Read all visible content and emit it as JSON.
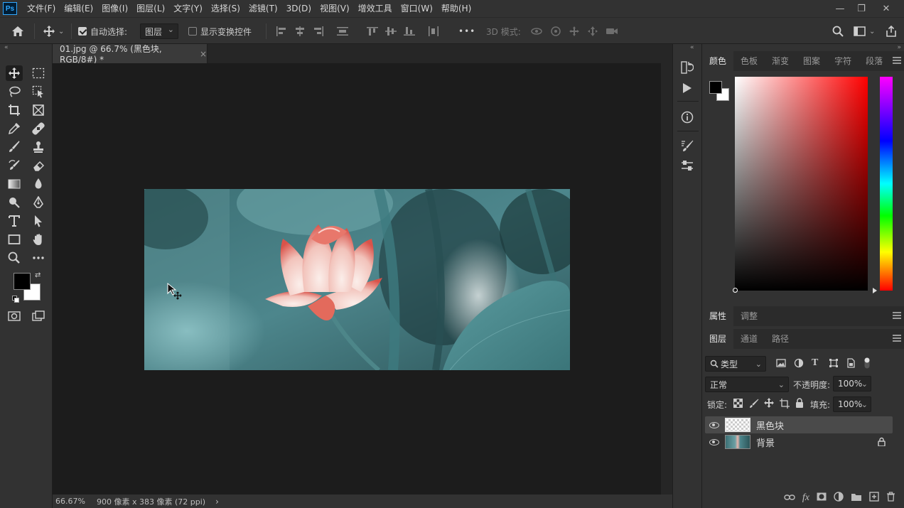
{
  "app": {
    "logo": "Ps"
  },
  "menu": [
    "文件(F)",
    "编辑(E)",
    "图像(I)",
    "图层(L)",
    "文字(Y)",
    "选择(S)",
    "滤镜(T)",
    "3D(D)",
    "视图(V)",
    "增效工具",
    "窗口(W)",
    "帮助(H)"
  ],
  "options": {
    "auto_select_label": "自动选择:",
    "auto_select_checked": true,
    "auto_select_target": "图层",
    "show_transform_label": "显示变换控件",
    "show_transform_checked": false,
    "mode3d_label": "3D 模式:",
    "more": "•••"
  },
  "document": {
    "tab_title": "01.jpg @ 66.7% (黑色块, RGB/8#) *",
    "close": "×"
  },
  "status": {
    "zoom": "66.67%",
    "info": "900 像素 x 383 像素 (72 ppi)",
    "arrow": "›"
  },
  "color_panel": {
    "tabs": [
      "颜色",
      "色板",
      "渐变",
      "图案",
      "字符",
      "段落"
    ],
    "selected_tab": "颜色",
    "foreground": "#000000",
    "background": "#ffffff",
    "hue_base": "#ff0000"
  },
  "properties_panel": {
    "tabs": [
      "属性",
      "调整"
    ]
  },
  "layers_panel": {
    "tabs": [
      "图层",
      "通道",
      "路径"
    ],
    "filter_label": "类型",
    "blend_mode": "正常",
    "opacity_label": "不透明度:",
    "opacity_value": "100%",
    "lock_label": "锁定:",
    "fill_label": "填充:",
    "fill_value": "100%",
    "layers": [
      {
        "name": "黑色块",
        "visible": true,
        "selected": true,
        "locked": false
      },
      {
        "name": "背景",
        "visible": true,
        "selected": false,
        "locked": true
      }
    ]
  },
  "colors": {
    "canvas_bg": "#1c1c1c",
    "panel_bg": "#323232",
    "accent": "#31a8ff"
  }
}
